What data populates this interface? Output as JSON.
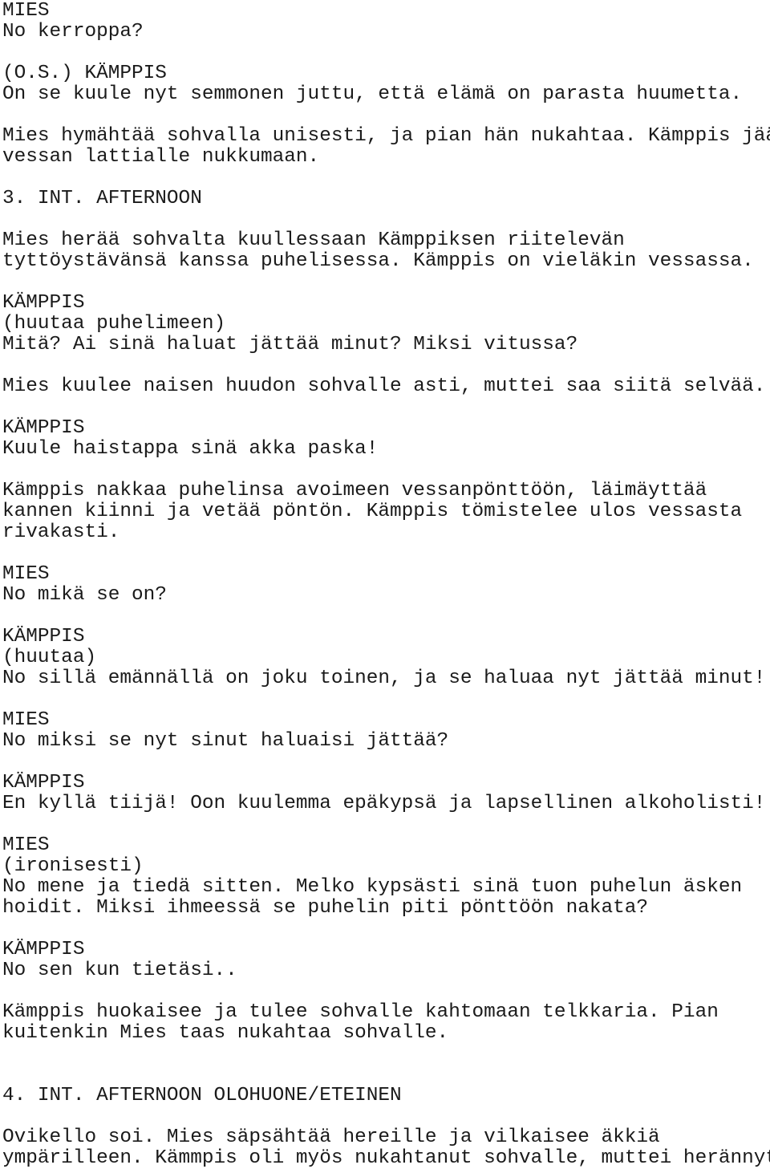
{
  "document": {
    "type": "screenplay",
    "language": "fi",
    "page_background": "#ffffff",
    "text_color": "#1a1a1a"
  },
  "blocks": [
    {
      "kind": "character",
      "name": "character-cue-mies",
      "lines": [
        "MIES"
      ]
    },
    {
      "kind": "dialogue",
      "name": "dialogue-mies",
      "lines": [
        "No kerroppa?"
      ]
    },
    {
      "kind": "blank",
      "name": "blank-line",
      "lines": [
        ""
      ]
    },
    {
      "kind": "character",
      "name": "character-cue-kamppis-os",
      "lines": [
        "(O.S.) KÄMPPIS"
      ]
    },
    {
      "kind": "dialogue",
      "name": "dialogue-kamppis",
      "lines": [
        "On se kuule nyt semmonen juttu, että elämä on parasta huumetta."
      ]
    },
    {
      "kind": "blank",
      "name": "blank-line",
      "lines": [
        ""
      ]
    },
    {
      "kind": "action",
      "name": "action-paragraph",
      "lines": [
        "Mies hymähtää sohvalla unisesti, ja pian hän nukahtaa. Kämppis jää",
        "vessan lattialle nukkumaan."
      ]
    },
    {
      "kind": "blank",
      "name": "blank-line",
      "lines": [
        ""
      ]
    },
    {
      "kind": "scene-heading",
      "name": "scene-heading-3",
      "lines": [
        "3. INT. AFTERNOON"
      ]
    },
    {
      "kind": "blank",
      "name": "blank-line",
      "lines": [
        ""
      ]
    },
    {
      "kind": "action",
      "name": "action-paragraph",
      "lines": [
        "Mies herää sohvalta kuullessaan Kämppiksen riitelevän",
        "tyttöystävänsä kanssa puhelisessa. Kämppis on vieläkin vessassa."
      ]
    },
    {
      "kind": "blank",
      "name": "blank-line",
      "lines": [
        ""
      ]
    },
    {
      "kind": "character",
      "name": "character-cue-kamppis",
      "lines": [
        "KÄMPPIS"
      ]
    },
    {
      "kind": "parenthetical",
      "name": "parenthetical-direction",
      "lines": [
        "(huutaa puhelimeen)"
      ]
    },
    {
      "kind": "dialogue",
      "name": "dialogue-kamppis",
      "lines": [
        "Mitä? Ai sinä haluat jättää minut? Miksi vitussa?"
      ]
    },
    {
      "kind": "blank",
      "name": "blank-line",
      "lines": [
        ""
      ]
    },
    {
      "kind": "action",
      "name": "action-paragraph",
      "lines": [
        "Mies kuulee naisen huudon sohvalle asti, muttei saa siitä selvää."
      ]
    },
    {
      "kind": "blank",
      "name": "blank-line",
      "lines": [
        ""
      ]
    },
    {
      "kind": "character",
      "name": "character-cue-kamppis",
      "lines": [
        "KÄMPPIS"
      ]
    },
    {
      "kind": "dialogue",
      "name": "dialogue-kamppis",
      "lines": [
        "Kuule haistappa sinä akka paska!"
      ]
    },
    {
      "kind": "blank",
      "name": "blank-line",
      "lines": [
        ""
      ]
    },
    {
      "kind": "action",
      "name": "action-paragraph",
      "lines": [
        "Kämppis nakkaa puhelinsa avoimeen vessanpönttöön, läimäyttää",
        "kannen kiinni ja vetää pöntön. Kämppis tömistelee ulos vessasta",
        "rivakasti."
      ]
    },
    {
      "kind": "blank",
      "name": "blank-line",
      "lines": [
        ""
      ]
    },
    {
      "kind": "character",
      "name": "character-cue-mies",
      "lines": [
        "MIES"
      ]
    },
    {
      "kind": "dialogue",
      "name": "dialogue-mies",
      "lines": [
        "No mikä se on?"
      ]
    },
    {
      "kind": "blank",
      "name": "blank-line",
      "lines": [
        ""
      ]
    },
    {
      "kind": "character",
      "name": "character-cue-kamppis",
      "lines": [
        "KÄMPPIS"
      ]
    },
    {
      "kind": "parenthetical",
      "name": "parenthetical-direction",
      "lines": [
        "(huutaa)"
      ]
    },
    {
      "kind": "dialogue",
      "name": "dialogue-kamppis",
      "lines": [
        "No sillä emännällä on joku toinen, ja se haluaa nyt jättää minut!"
      ]
    },
    {
      "kind": "blank",
      "name": "blank-line",
      "lines": [
        ""
      ]
    },
    {
      "kind": "character",
      "name": "character-cue-mies",
      "lines": [
        "MIES"
      ]
    },
    {
      "kind": "dialogue",
      "name": "dialogue-mies",
      "lines": [
        "No miksi se nyt sinut haluaisi jättää?"
      ]
    },
    {
      "kind": "blank",
      "name": "blank-line",
      "lines": [
        ""
      ]
    },
    {
      "kind": "character",
      "name": "character-cue-kamppis",
      "lines": [
        "KÄMPPIS"
      ]
    },
    {
      "kind": "dialogue",
      "name": "dialogue-kamppis",
      "lines": [
        "En kyllä tiijä! Oon kuulemma epäkypsä ja lapsellinen alkoholisti!"
      ]
    },
    {
      "kind": "blank",
      "name": "blank-line",
      "lines": [
        ""
      ]
    },
    {
      "kind": "character",
      "name": "character-cue-mies",
      "lines": [
        "MIES"
      ]
    },
    {
      "kind": "parenthetical",
      "name": "parenthetical-direction",
      "lines": [
        "(ironisesti)"
      ]
    },
    {
      "kind": "dialogue",
      "name": "dialogue-mies",
      "lines": [
        "No mene ja tiedä sitten. Melko kypsästi sinä tuon puhelun äsken",
        "hoidit. Miksi ihmeessä se puhelin piti pönttöön nakata?"
      ]
    },
    {
      "kind": "blank",
      "name": "blank-line",
      "lines": [
        ""
      ]
    },
    {
      "kind": "character",
      "name": "character-cue-kamppis",
      "lines": [
        "KÄMPPIS"
      ]
    },
    {
      "kind": "dialogue",
      "name": "dialogue-kamppis",
      "lines": [
        "No sen kun tietäsi.."
      ]
    },
    {
      "kind": "blank",
      "name": "blank-line",
      "lines": [
        ""
      ]
    },
    {
      "kind": "action",
      "name": "action-paragraph",
      "lines": [
        "Kämppis huokaisee ja tulee sohvalle kahtomaan telkkaria. Pian",
        "kuitenkin Mies taas nukahtaa sohvalle."
      ]
    },
    {
      "kind": "blank",
      "name": "blank-line",
      "lines": [
        ""
      ]
    },
    {
      "kind": "blank",
      "name": "blank-line",
      "lines": [
        ""
      ]
    },
    {
      "kind": "scene-heading",
      "name": "scene-heading-4",
      "lines": [
        "4. INT. AFTERNOON OLOHUONE/ETEINEN"
      ]
    },
    {
      "kind": "blank",
      "name": "blank-line",
      "lines": [
        ""
      ]
    },
    {
      "kind": "action",
      "name": "action-paragraph",
      "lines": [
        "Ovikello soi. Mies säpsähtää hereille ja vilkaisee äkkiä",
        "ympärilleen. Kämmpis oli myös nukahtanut sohvalle, muttei herännyt"
      ]
    }
  ]
}
